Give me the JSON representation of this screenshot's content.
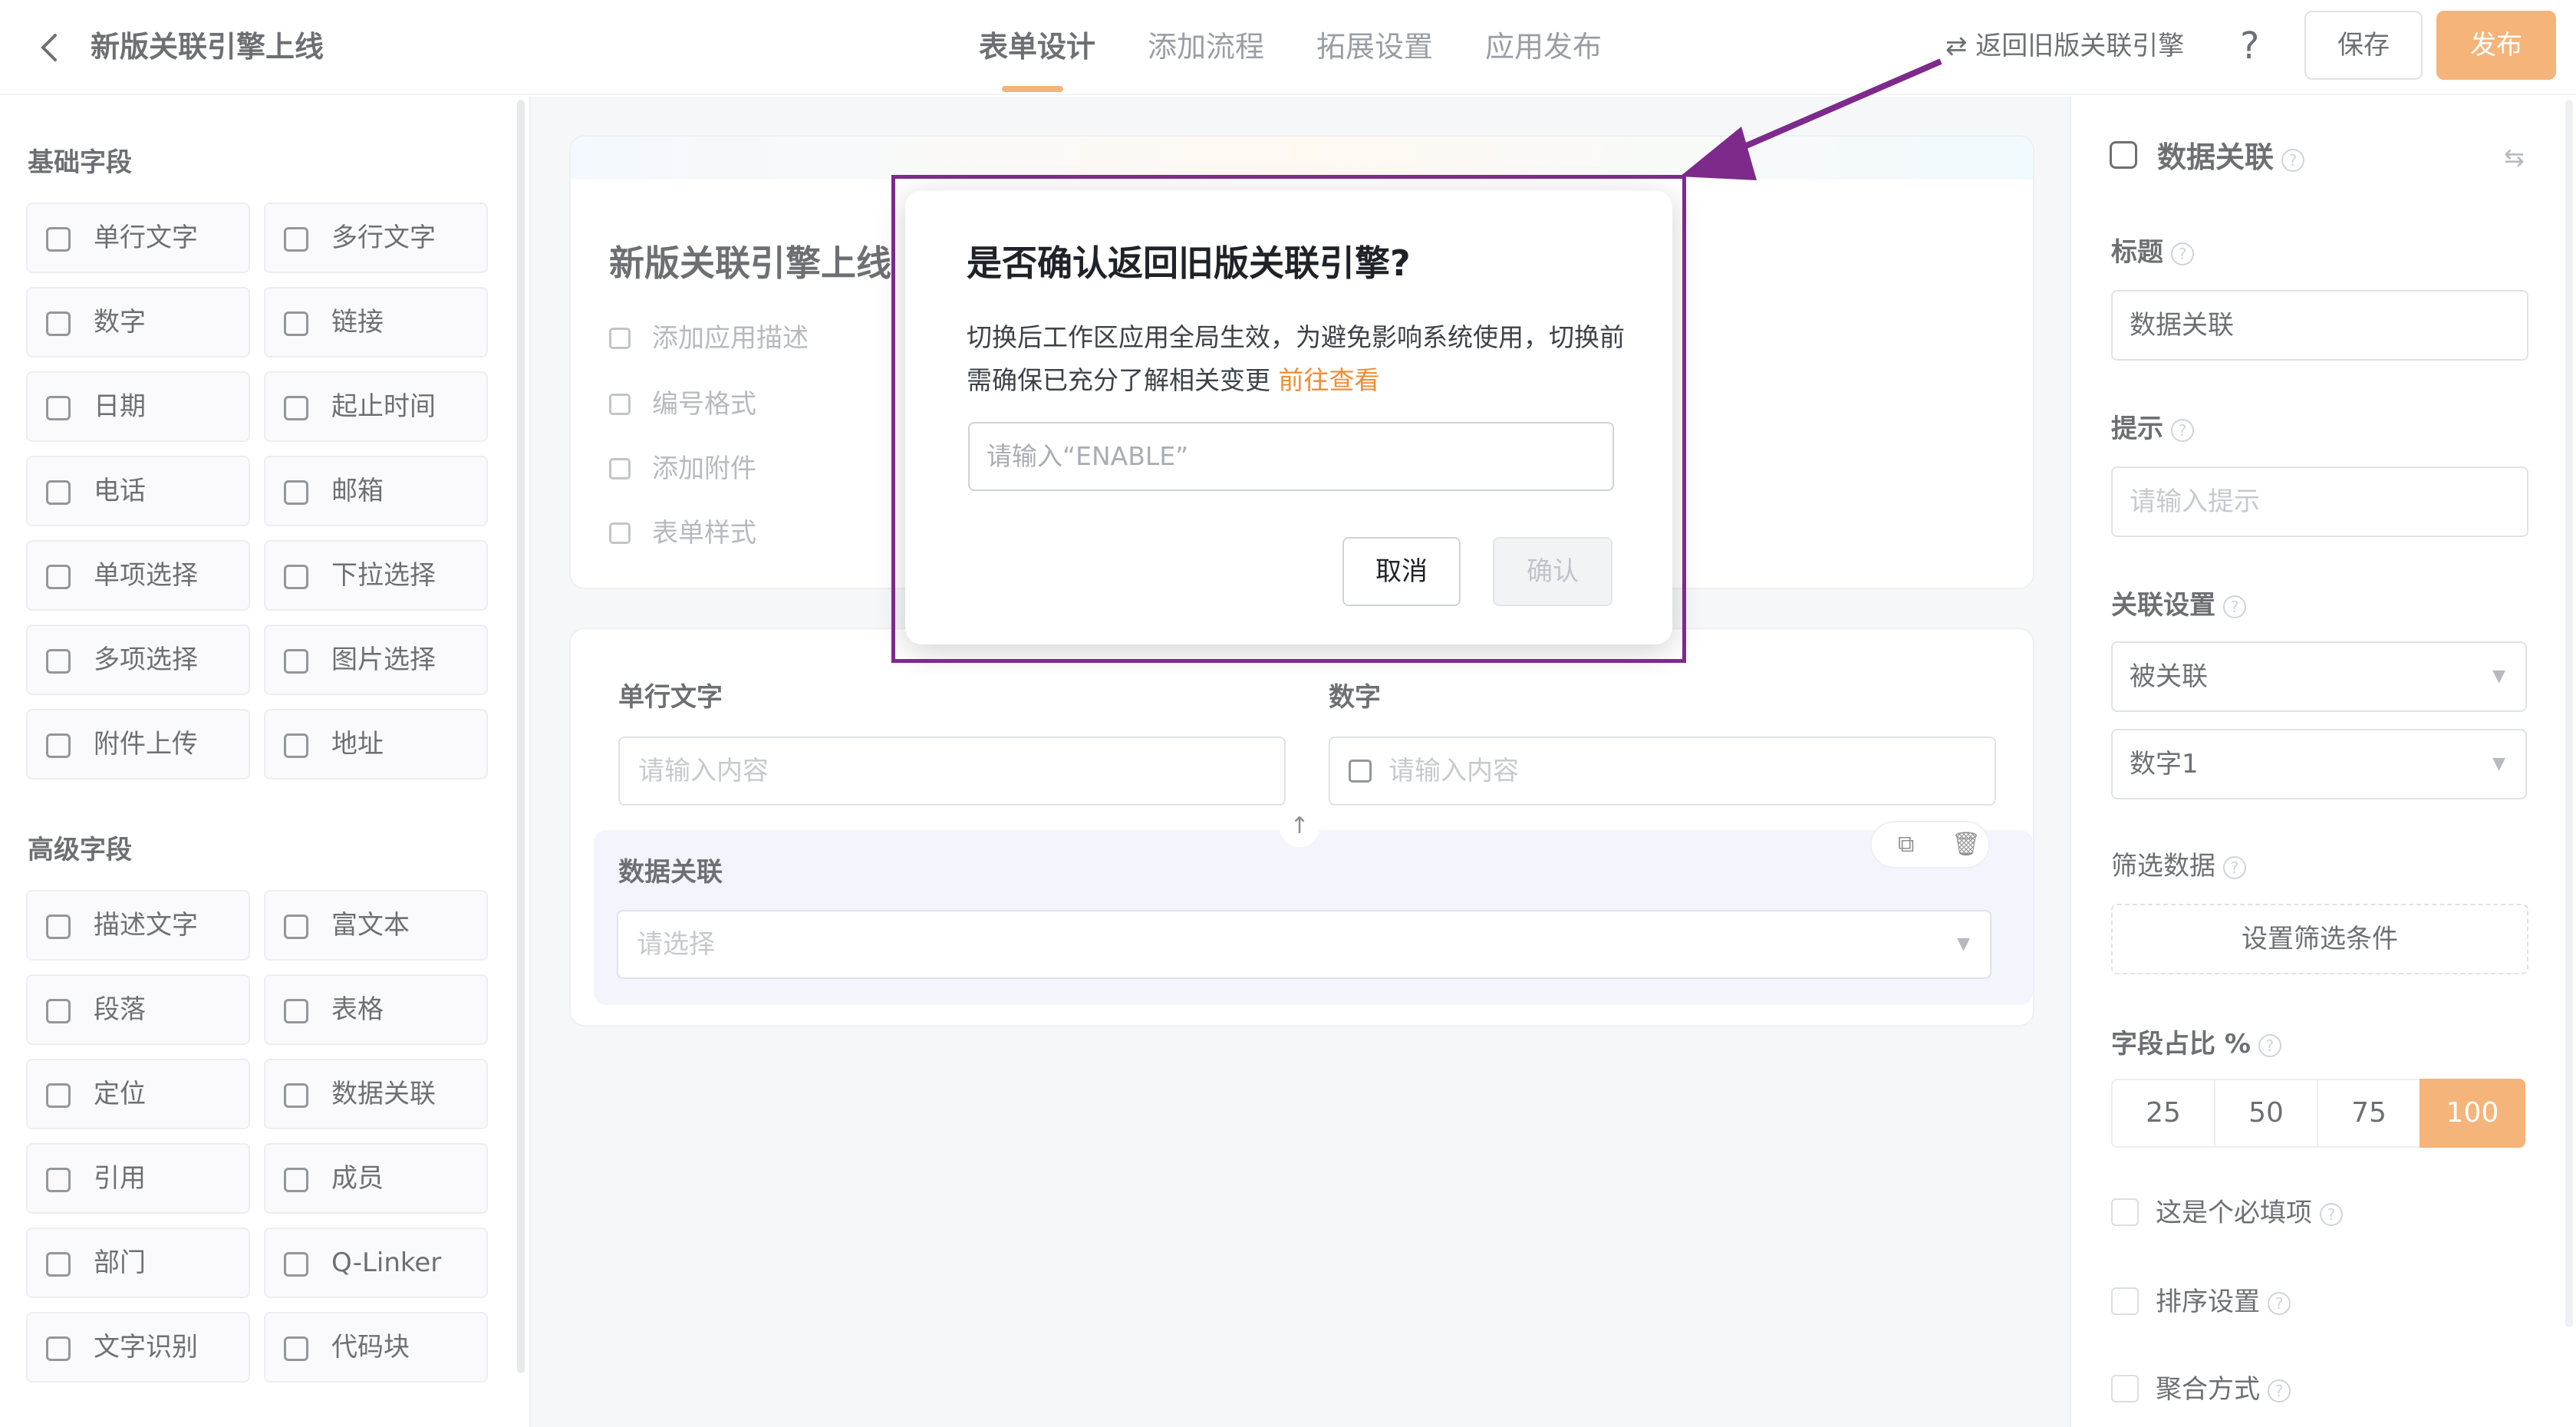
{
  "header": {
    "title": "新版关联引擎上线",
    "tabs": [
      "表单设计",
      "添加流程",
      "拓展设置",
      "应用发布"
    ],
    "switch_link": "⇄ 返回旧版关联引擎",
    "help": "?",
    "save": "保存",
    "publish": "发布"
  },
  "sidebar": {
    "basic_title": "基础字段",
    "basic": [
      "单行文字",
      "多行文字",
      "数字",
      "链接",
      "日期",
      "起止时间",
      "电话",
      "邮箱",
      "单项选择",
      "下拉选择",
      "多项选择",
      "图片选择",
      "附件上传",
      "地址"
    ],
    "advanced_title": "高级字段",
    "advanced": [
      "描述文字",
      "富文本",
      "段落",
      "表格",
      "定位",
      "数据关联",
      "引用",
      "成员",
      "部门",
      "Q-Linker",
      "文字识别",
      "代码块"
    ]
  },
  "form": {
    "title": "新版关联引擎上线",
    "options": [
      "添加应用描述",
      "编号格式",
      "添加附件",
      "表单样式"
    ],
    "field1_label": "单行文字",
    "field1_placeholder": "请输入内容",
    "field2_label": "数字",
    "field2_placeholder": "请输入内容",
    "field3_label": "数据关联",
    "field3_placeholder": "请选择"
  },
  "props": {
    "panel_title": "数据关联",
    "title_label": "标题",
    "title_value": "数据关联",
    "hint_label": "提示",
    "hint_placeholder": "请输入提示",
    "relation_label": "关联设置",
    "relation_value": "被关联",
    "relation_field": "数字1",
    "filter_label": "筛选数据",
    "filter_button": "设置筛选条件",
    "ratio_label": "字段占比 %",
    "ratio_options": [
      "25",
      "50",
      "75",
      "100"
    ],
    "ratio_selected": "100",
    "checks": [
      "这是个必填项",
      "排序设置",
      "聚合方式"
    ]
  },
  "dialog": {
    "title": "是否确认返回旧版关联引擎?",
    "body": "切换后工作区应用全局生效，为避免影响系统使用，切换前需确保已充分了解相关变更",
    "link": "前往查看",
    "input_placeholder": "请输入“ENABLE”",
    "cancel": "取消",
    "confirm": "确认"
  },
  "colors": {
    "accent": "#f08c34",
    "annotation": "#7d2a8c"
  }
}
